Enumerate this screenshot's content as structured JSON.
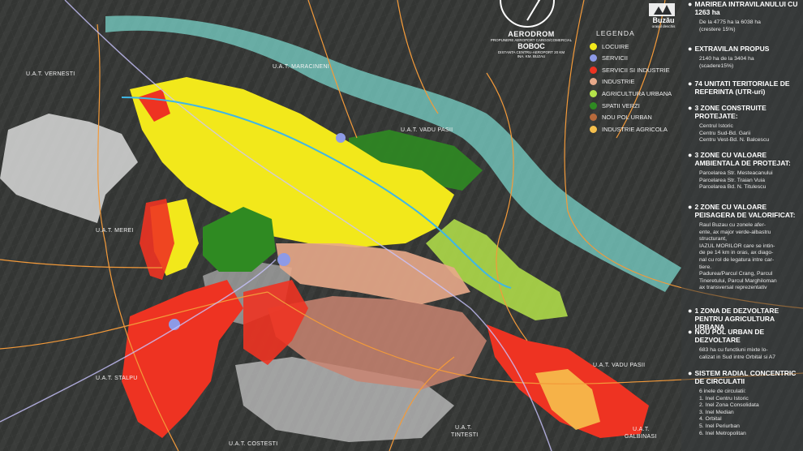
{
  "colors": {
    "locuire": "#f2e81b",
    "servicii": "#8d9ae6",
    "servicii_industrie": "#ee3322",
    "industrie": "#e8a98a",
    "agricultura_urbana": "#b5e34a",
    "spatii_verzi": "#2f8a22",
    "nou_pol_urban": "#b86a3c",
    "industrie_agricola": "#f6c04d",
    "river": "#7ad3c9",
    "road": "#f39a3a",
    "extravilan": "#d6d6d6",
    "background": "#2b2d2f"
  },
  "header": {
    "title": "AERODROM",
    "subtitle": "PROPUNERE AEROPORT CARGO/COMERCIAL",
    "name": "BOBOC",
    "distance": "DISTANTA CENTRU-AEROPORT 20 KM",
    "note": "INA. KM. BUZAU"
  },
  "logo": {
    "name": "Buzău",
    "tagline": "orașul deschis"
  },
  "legend": {
    "title": "LEGENDA",
    "items": [
      {
        "label": "LOCUIRE",
        "color": "#f2e81b"
      },
      {
        "label": "SERVICII",
        "color": "#8d9ae6"
      },
      {
        "label": "SERVICII SI INDUSTRIE",
        "color": "#ee3322"
      },
      {
        "label": "INDUSTRIE",
        "color": "#e8a98a"
      },
      {
        "label": "AGRICULTURA URBANA",
        "color": "#b5e34a"
      },
      {
        "label": "SPATII VERZI",
        "color": "#2f8a22"
      },
      {
        "label": "NOU POL URBAN",
        "color": "#b86a3c"
      },
      {
        "label": "INDUSTRIE AGRICOLA",
        "color": "#f6c04d"
      }
    ]
  },
  "uat_labels": [
    {
      "text": "U.A.T. VERNESTI"
    },
    {
      "text": "U.A.T. MARACINENI"
    },
    {
      "text": "U.A.T. VADU PASII"
    },
    {
      "text": "U.A.T. MEREI"
    },
    {
      "text": "U.A.T. STALPU"
    },
    {
      "text": "U.A.T. COSTESTI"
    },
    {
      "text": "U.A.T."
    },
    {
      "text": "TINTESTI"
    },
    {
      "text": "U.A.T. VADU PASII"
    },
    {
      "text": "U.A.T."
    },
    {
      "text": "GALBINASI"
    }
  ],
  "panel": {
    "sections": [
      {
        "head": "MARIREA INTRAVILANULUI CU 1263 ha",
        "lines": [
          "De la 4775 ha la 6038 ha",
          "(crestere 15%)"
        ]
      },
      {
        "head": "EXTRAVILAN PROPUS",
        "lines": [
          "2140 ha de la 3404 ha",
          "(scadere15%)"
        ]
      },
      {
        "head": "74 UNITATI TERITORIALE DE REFERINTA (UTR-uri)",
        "lines": []
      },
      {
        "head": "3 ZONE CONSTRUITE PROTEJATE:",
        "lines": [
          "Centrul Istoric",
          "Centru Sud-Bd. Garii",
          "Centru Vest-Bd. N. Balcescu"
        ]
      },
      {
        "head": "3 ZONE CU VALOARE AMBIENTALA DE PROTEJAT:",
        "lines": [
          "Parcelarea Str. Mesteacanului",
          "Parcelarea Str. Traian Vuia",
          "Parcelarea Bd. N. Titulescu"
        ]
      },
      {
        "head": "2 ZONE CU VALOARE PEISAGERA DE VALORIFICAT:",
        "lines": [
          "Raul Buzau cu zonele afer-",
          "ente, ax major verde-albastru",
          "structurant,",
          "IAZUL MORILOR care se intin-",
          "de pe 14 km in oras, ax diago-",
          "nal cu rol de legatura intre car-",
          "tiere.",
          "Padurea/Parcul Crang, Parcul",
          "Tineretului, Parcul Marghiloman",
          "ax transversal reprezentativ"
        ]
      },
      {
        "head": "1 ZONA DE DEZVOLTARE PENTRU AGRICULTURA URBANA",
        "lines": []
      },
      {
        "head": "NOU POL URBAN DE DEZVOLTARE",
        "lines": [
          "683 ha cu functiuni mixte lo-",
          "calizat in Sud intre Orbital si A7"
        ]
      },
      {
        "head": "SISTEM RADIAL CONCENTRIC DE CIRCULATII",
        "lines": [
          "6 inele de circulatii:",
          "1. Inel Centru Istoric",
          "2. Inel Zona Consolidata",
          "3. Inel Median",
          "4. Orbital",
          "5. Inel Periurban",
          "6. Inel Metropolitan"
        ]
      }
    ]
  }
}
